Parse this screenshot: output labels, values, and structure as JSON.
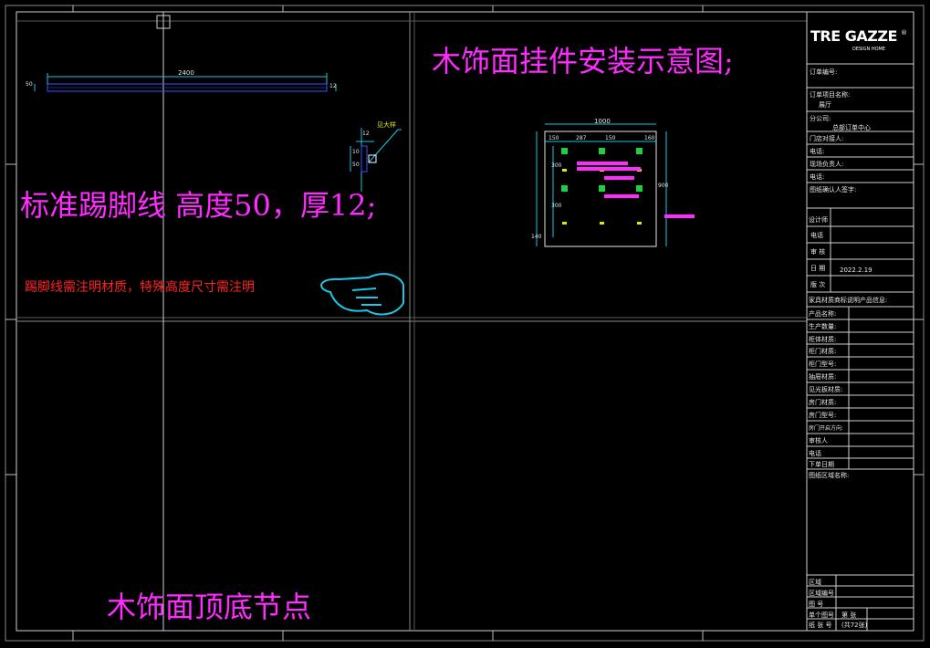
{
  "drawing": {
    "title_hangers": "木饰面挂件安装示意图;",
    "title_skirting": "标准踢脚线 高度50，厚12;",
    "note_skirting": "踢脚线需注明材质，特殊高度尺寸需注明",
    "title_top_bottom": "木饰面顶底节点",
    "skirting_length": "2400",
    "skirting_height_label": "50",
    "skirting_thick_label": "12",
    "section_tag": "见大样",
    "section_dim_a": "12",
    "section_dim_b": "10",
    "section_dim_c": "50",
    "panel_width": "1000",
    "panel_height": "900",
    "panel_dims": [
      "150",
      "287",
      "150",
      "160"
    ],
    "panel_left_dims": [
      "300",
      "300"
    ],
    "panel_bottom_dim": "140"
  },
  "colors": {
    "background": "#000000",
    "magenta": "#ff2bff",
    "red": "#ff2020",
    "cyan": "#19c8e6",
    "blue": "#3a52ff",
    "white": "#e6e6e6",
    "green": "#20d040",
    "yellow": "#e6e600"
  },
  "title_block": {
    "logo": "TRE GAZZE",
    "logo_sub": "DESIGN HOME",
    "order_no_label": "订单编号:",
    "project_label": "订单项目名称:",
    "project_value": "展厅",
    "branch_label": "分公司:",
    "branch_value": "总部订单中心",
    "store_contact_label": "门店对接人:",
    "phone1_label": "电话:",
    "site_owner_label": "现场负责人:",
    "phone2_label": "电话:",
    "confirm_label": "图纸确认人签字:",
    "designer_label": "设计师",
    "phone3_label": "电话",
    "reviewer_label": "审  核",
    "date_label": "日  期",
    "date_value": "2022.2.19",
    "version_label": "版  次",
    "info_header": "家具材质商标说明产品信息:",
    "fields": [
      "产品名称:",
      "生产数量:",
      "柜体材质:",
      "柜门材质:",
      "柜门型号:",
      "抽屉材质:",
      "见光板材质:",
      "房门材质:",
      "房门型号:",
      "房门开启方向:",
      "审核人",
      "电话",
      "下单日期"
    ],
    "area_name_label": "图纸区域名称:",
    "area_label": "区域",
    "area_no_label": "区域编号",
    "drawing_no_label": "图  号",
    "single_sheet_label": "单个图号",
    "sheet_label": "第   张",
    "paper_no_label": "纸 张 号",
    "total_label": "(共72张)"
  }
}
